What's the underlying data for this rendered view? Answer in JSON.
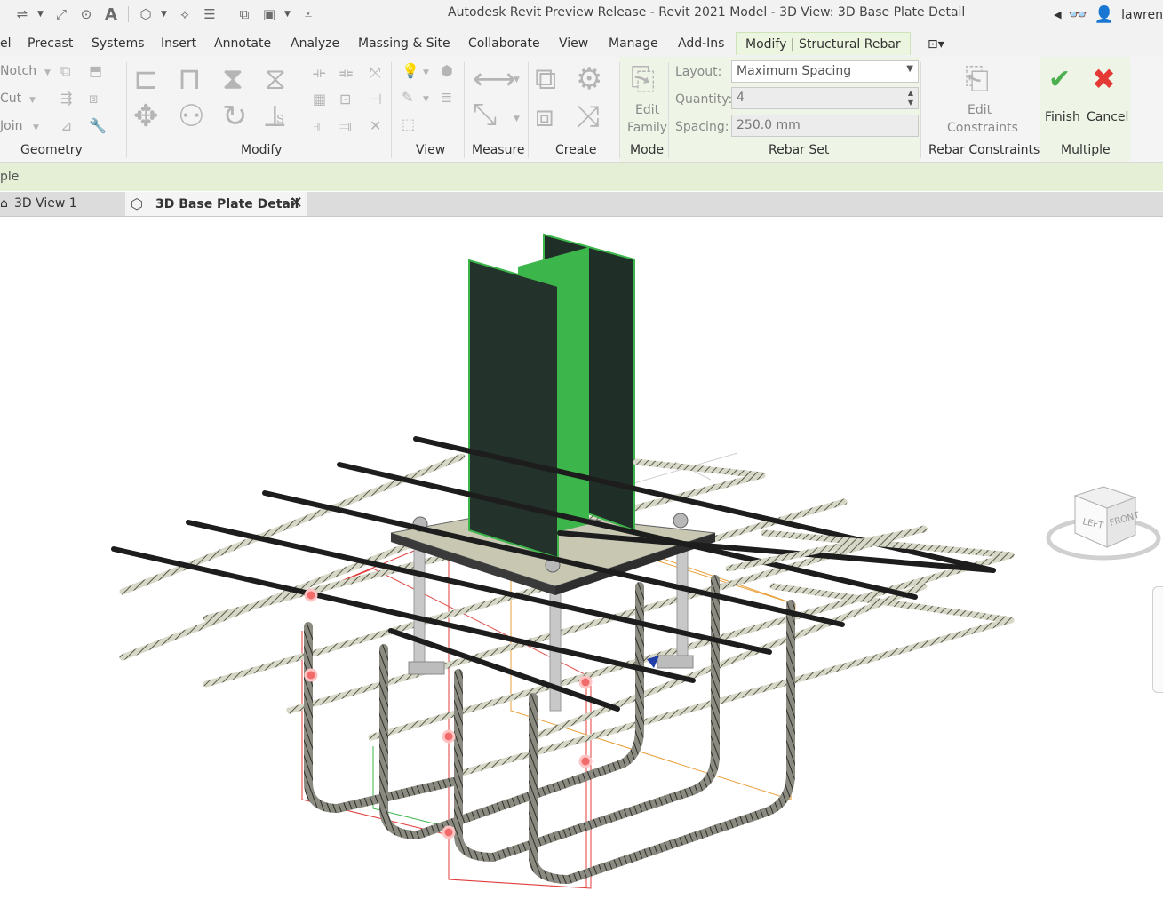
{
  "window": {
    "title": "Autodesk Revit Preview Release - Revit 2021 Model - 3D View: 3D Base Plate Detail",
    "user": "lawren"
  },
  "qat": [
    "hatch-icon",
    "measure-icon",
    "tag-icon",
    "text-icon",
    "3d-view-icon",
    "section-icon",
    "thin-lines-icon",
    "close-windows-icon",
    "switch-windows-icon",
    "customize-icon"
  ],
  "menu_tabs": [
    "el",
    "Precast",
    "Systems",
    "Insert",
    "Annotate",
    "Analyze",
    "Massing & Site",
    "Collaborate",
    "View",
    "Manage",
    "Add-Ins",
    "Modify | Structural Rebar"
  ],
  "ribbon": {
    "geometry": {
      "title": "Geometry",
      "items": [
        "Notch",
        "Cut",
        "Join"
      ]
    },
    "modify": {
      "title": "Modify"
    },
    "view": {
      "title": "View"
    },
    "measure": {
      "title": "Measure"
    },
    "create": {
      "title": "Create"
    },
    "mode": {
      "title": "Mode",
      "edit_family": "Edit Family"
    },
    "rebar_set": {
      "title": "Rebar Set",
      "layout_label": "Layout:",
      "layout_value": "Maximum Spacing",
      "quantity_label": "Quantity:",
      "quantity_value": "4",
      "spacing_label": "Spacing:",
      "spacing_value": "250.0 mm"
    },
    "rebar_constraints": {
      "title": "Rebar Constraints",
      "edit_constraints": "Edit Constraints"
    },
    "multiple": {
      "title": "Multiple",
      "finish": "Finish",
      "cancel": "Cancel"
    }
  },
  "options_bar": {
    "text": "ple"
  },
  "view_tabs": [
    "3D View 1",
    "3D Base Plate Detail"
  ],
  "viewcube": {
    "left": "LEFT",
    "front": "FRONT"
  },
  "colors": {
    "accent_green": "#3cb54a",
    "ribbon_active": "#ebf5df",
    "finish_green": "#4caf50",
    "cancel_red": "#e53935"
  }
}
